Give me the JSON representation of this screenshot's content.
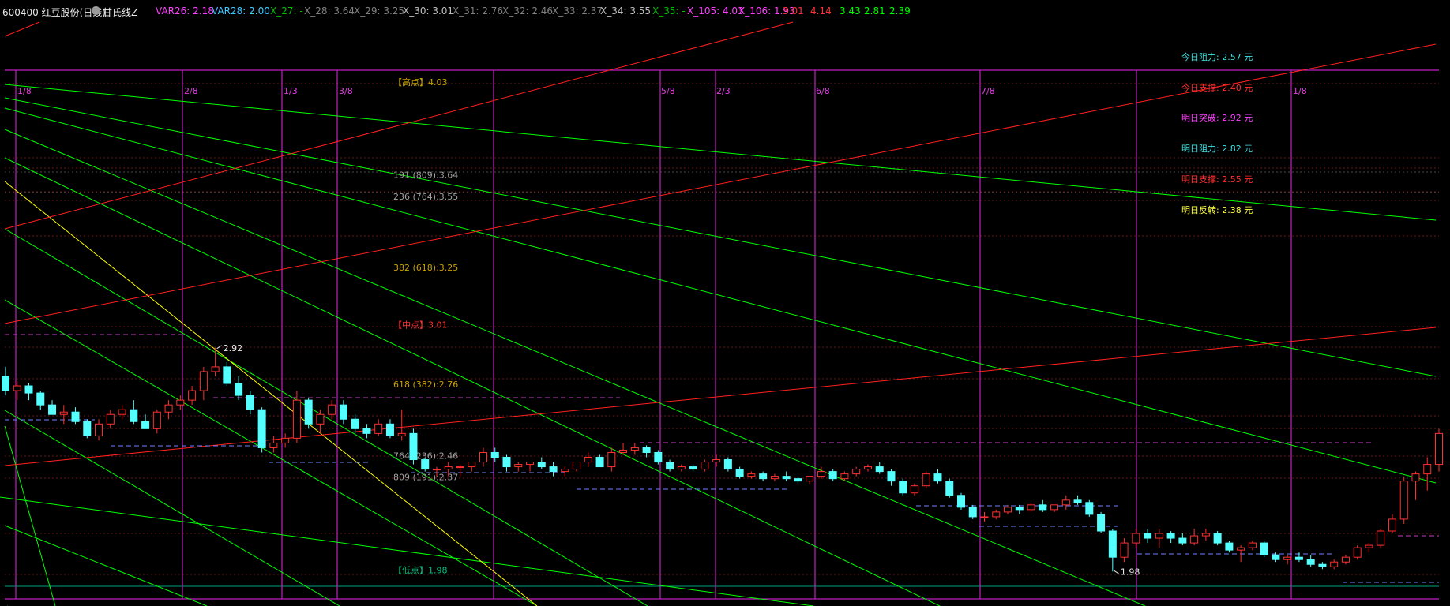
{
  "header": {
    "stock": "600400 红豆股份(日线)",
    "indicator": "甘氏线Z",
    "items": [
      {
        "text": "VAR26: 2.18",
        "color": "#ff40ff"
      },
      {
        "text": "VAR28: 2.00",
        "color": "#40c8ff"
      },
      {
        "text": "X_27: -",
        "color": "#00c000"
      },
      {
        "text": "X_28: 3.64",
        "color": "#808080"
      },
      {
        "text": "X_29: 3.25",
        "color": "#808080"
      },
      {
        "text": "X_30: 3.01",
        "color": "#c0c0c0"
      },
      {
        "text": "X_31: 2.76",
        "color": "#808080"
      },
      {
        "text": "X_32: 2.46",
        "color": "#808080"
      },
      {
        "text": "X_33: 2.37",
        "color": "#808080"
      },
      {
        "text": "X_34: 3.55",
        "color": "#c0c0c0"
      },
      {
        "text": "X_35: -",
        "color": "#00c000"
      },
      {
        "text": "X_105: 4.03",
        "color": "#ff40ff"
      },
      {
        "text": "X_106: 1.93",
        "color": "#ff40ff"
      },
      {
        "text": "3.01",
        "color": "#ff3030"
      },
      {
        "text": "4.14",
        "color": "#ff3030"
      },
      {
        "text": "3.43",
        "color": "#00ff00"
      },
      {
        "text": "2.81",
        "color": "#00ff00"
      },
      {
        "text": "2.39",
        "color": "#00ff00"
      }
    ]
  },
  "dates": [
    "1/8",
    "2/8",
    "1/3",
    "3/8",
    "5/8",
    "2/3",
    "6/8",
    "7/8",
    "1/8"
  ],
  "fib_levels": [
    {
      "label": "【高点】4.03",
      "value": 4.03,
      "color": "#c8a000"
    },
    {
      "label": "191 (809):3.64",
      "value": 3.64,
      "color": "#a0a0a0"
    },
    {
      "label": "236 (764):3.55",
      "value": 3.55,
      "color": "#a0a0a0"
    },
    {
      "label": "382 (618):3.25",
      "value": 3.25,
      "color": "#c8a000"
    },
    {
      "label": "【中点】3.01",
      "value": 3.01,
      "color": "#ff3030"
    },
    {
      "label": "618 (382):2.76",
      "value": 2.76,
      "color": "#c8a000"
    },
    {
      "label": "764 (236):2.46",
      "value": 2.46,
      "color": "#a0a0a0"
    },
    {
      "label": "809 (191):2.37",
      "value": 2.37,
      "color": "#a0a0a0"
    },
    {
      "label": "【低点】1.98",
      "value": 1.98,
      "color": "#00c080"
    }
  ],
  "right_panel": [
    {
      "label": "今日阻力: ",
      "value": "2.57 元",
      "color": "#40e0e0"
    },
    {
      "label": "今日支撑: ",
      "value": "2.40 元",
      "color": "#ff3030"
    },
    {
      "label": "明日突破: ",
      "value": "2.92 元",
      "color": "#ff40ff"
    },
    {
      "label": "明日阻力: ",
      "value": "2.82 元",
      "color": "#40e0e0"
    },
    {
      "label": "明日支撑: ",
      "value": "2.55 元",
      "color": "#ff3030"
    },
    {
      "label": "明日反转: ",
      "value": "2.38 元",
      "color": "#ffff40"
    }
  ],
  "peak_label": "2.92",
  "trough_label": "1.98",
  "colors": {
    "up": "#ff3030",
    "down": "#54ffff",
    "purple": "#c020c0",
    "green": "#00ff00",
    "red": "#ff2020",
    "yellow": "#ffff00"
  },
  "chart_data": {
    "type": "candlestick",
    "ylim": [
      1.9,
      4.34
    ],
    "ohlc": [
      [
        2.8,
        2.84,
        2.72,
        2.74
      ],
      [
        2.74,
        2.78,
        2.7,
        2.76
      ],
      [
        2.76,
        2.77,
        2.7,
        2.73
      ],
      [
        2.73,
        2.74,
        2.66,
        2.68
      ],
      [
        2.68,
        2.7,
        2.64,
        2.64
      ],
      [
        2.64,
        2.68,
        2.6,
        2.65
      ],
      [
        2.65,
        2.67,
        2.6,
        2.61
      ],
      [
        2.61,
        2.62,
        2.54,
        2.55
      ],
      [
        2.55,
        2.62,
        2.53,
        2.6
      ],
      [
        2.6,
        2.66,
        2.58,
        2.64
      ],
      [
        2.64,
        2.68,
        2.62,
        2.66
      ],
      [
        2.66,
        2.7,
        2.6,
        2.61
      ],
      [
        2.61,
        2.64,
        2.58,
        2.58
      ],
      [
        2.58,
        2.66,
        2.56,
        2.65
      ],
      [
        2.65,
        2.7,
        2.62,
        2.68
      ],
      [
        2.68,
        2.72,
        2.66,
        2.7
      ],
      [
        2.7,
        2.76,
        2.68,
        2.74
      ],
      [
        2.74,
        2.84,
        2.7,
        2.82
      ],
      [
        2.82,
        2.92,
        2.8,
        2.84
      ],
      [
        2.84,
        2.86,
        2.76,
        2.77
      ],
      [
        2.77,
        2.8,
        2.7,
        2.72
      ],
      [
        2.72,
        2.74,
        2.64,
        2.66
      ],
      [
        2.66,
        2.67,
        2.48,
        2.5
      ],
      [
        2.5,
        2.55,
        2.48,
        2.52
      ],
      [
        2.52,
        2.56,
        2.5,
        2.54
      ],
      [
        2.54,
        2.74,
        2.52,
        2.7
      ],
      [
        2.7,
        2.71,
        2.58,
        2.6
      ],
      [
        2.6,
        2.66,
        2.56,
        2.64
      ],
      [
        2.64,
        2.7,
        2.62,
        2.68
      ],
      [
        2.68,
        2.7,
        2.6,
        2.62
      ],
      [
        2.62,
        2.64,
        2.56,
        2.58
      ],
      [
        2.58,
        2.6,
        2.54,
        2.56
      ],
      [
        2.56,
        2.62,
        2.55,
        2.6
      ],
      [
        2.6,
        2.62,
        2.54,
        2.55
      ],
      [
        2.55,
        2.66,
        2.53,
        2.56
      ],
      [
        2.56,
        2.58,
        2.43,
        2.45
      ],
      [
        2.45,
        2.46,
        2.4,
        2.41
      ],
      [
        2.41,
        2.42,
        2.38,
        2.41
      ],
      [
        2.41,
        2.44,
        2.38,
        2.42
      ],
      [
        2.42,
        2.43,
        2.38,
        2.42
      ],
      [
        2.42,
        2.44,
        2.4,
        2.44
      ],
      [
        2.44,
        2.5,
        2.42,
        2.48
      ],
      [
        2.48,
        2.5,
        2.44,
        2.46
      ],
      [
        2.46,
        2.47,
        2.4,
        2.42
      ],
      [
        2.42,
        2.44,
        2.4,
        2.43
      ],
      [
        2.43,
        2.44,
        2.4,
        2.44
      ],
      [
        2.44,
        2.46,
        2.41,
        2.42
      ],
      [
        2.42,
        2.44,
        2.38,
        2.4
      ],
      [
        2.4,
        2.42,
        2.38,
        2.41
      ],
      [
        2.41,
        2.44,
        2.4,
        2.44
      ],
      [
        2.44,
        2.48,
        2.42,
        2.46
      ],
      [
        2.46,
        2.47,
        2.42,
        2.42
      ],
      [
        2.42,
        2.5,
        2.4,
        2.48
      ],
      [
        2.48,
        2.52,
        2.47,
        2.49
      ],
      [
        2.49,
        2.52,
        2.47,
        2.5
      ],
      [
        2.5,
        2.51,
        2.46,
        2.48
      ],
      [
        2.48,
        2.49,
        2.43,
        2.44
      ],
      [
        2.44,
        2.45,
        2.4,
        2.41
      ],
      [
        2.41,
        2.43,
        2.4,
        2.42
      ],
      [
        2.42,
        2.43,
        2.4,
        2.41
      ],
      [
        2.41,
        2.45,
        2.4,
        2.44
      ],
      [
        2.44,
        2.47,
        2.42,
        2.45
      ],
      [
        2.45,
        2.46,
        2.4,
        2.41
      ],
      [
        2.41,
        2.42,
        2.37,
        2.38
      ],
      [
        2.38,
        2.4,
        2.37,
        2.39
      ],
      [
        2.39,
        2.4,
        2.36,
        2.37
      ],
      [
        2.37,
        2.39,
        2.36,
        2.38
      ],
      [
        2.38,
        2.4,
        2.36,
        2.37
      ],
      [
        2.37,
        2.38,
        2.35,
        2.36
      ],
      [
        2.36,
        2.38,
        2.35,
        2.38
      ],
      [
        2.38,
        2.42,
        2.37,
        2.4
      ],
      [
        2.4,
        2.41,
        2.36,
        2.37
      ],
      [
        2.37,
        2.4,
        2.36,
        2.39
      ],
      [
        2.39,
        2.42,
        2.38,
        2.41
      ],
      [
        2.41,
        2.43,
        2.4,
        2.42
      ],
      [
        2.42,
        2.44,
        2.39,
        2.4
      ],
      [
        2.4,
        2.41,
        2.34,
        2.36
      ],
      [
        2.36,
        2.37,
        2.3,
        2.31
      ],
      [
        2.31,
        2.35,
        2.3,
        2.34
      ],
      [
        2.34,
        2.4,
        2.33,
        2.39
      ],
      [
        2.39,
        2.41,
        2.35,
        2.36
      ],
      [
        2.36,
        2.37,
        2.29,
        2.3
      ],
      [
        2.3,
        2.31,
        2.24,
        2.25
      ],
      [
        2.25,
        2.26,
        2.2,
        2.21
      ],
      [
        2.21,
        2.23,
        2.19,
        2.21
      ],
      [
        2.21,
        2.24,
        2.2,
        2.23
      ],
      [
        2.23,
        2.26,
        2.22,
        2.25
      ],
      [
        2.25,
        2.26,
        2.22,
        2.24
      ],
      [
        2.24,
        2.27,
        2.23,
        2.26
      ],
      [
        2.26,
        2.28,
        2.23,
        2.24
      ],
      [
        2.24,
        2.26,
        2.23,
        2.26
      ],
      [
        2.26,
        2.3,
        2.24,
        2.28
      ],
      [
        2.28,
        2.3,
        2.26,
        2.27
      ],
      [
        2.27,
        2.28,
        2.21,
        2.22
      ],
      [
        2.22,
        2.23,
        2.14,
        2.15
      ],
      [
        2.15,
        2.16,
        1.98,
        2.04
      ],
      [
        2.04,
        2.12,
        2.02,
        2.1
      ],
      [
        2.1,
        2.16,
        2.08,
        2.14
      ],
      [
        2.14,
        2.16,
        2.1,
        2.12
      ],
      [
        2.12,
        2.16,
        2.08,
        2.14
      ],
      [
        2.14,
        2.15,
        2.1,
        2.12
      ],
      [
        2.12,
        2.14,
        2.09,
        2.1
      ],
      [
        2.1,
        2.16,
        2.09,
        2.13
      ],
      [
        2.13,
        2.16,
        2.11,
        2.14
      ],
      [
        2.14,
        2.15,
        2.09,
        2.1
      ],
      [
        2.1,
        2.11,
        2.06,
        2.07
      ],
      [
        2.07,
        2.09,
        2.02,
        2.08
      ],
      [
        2.08,
        2.11,
        2.07,
        2.1
      ],
      [
        2.1,
        2.11,
        2.04,
        2.05
      ],
      [
        2.05,
        2.06,
        2.02,
        2.03
      ],
      [
        2.03,
        2.05,
        2.01,
        2.04
      ],
      [
        2.04,
        2.06,
        2.02,
        2.03
      ],
      [
        2.03,
        2.05,
        2.0,
        2.01
      ],
      [
        2.01,
        2.02,
        1.99,
        2.0
      ],
      [
        2.0,
        2.03,
        1.99,
        2.02
      ],
      [
        2.02,
        2.05,
        2.01,
        2.04
      ],
      [
        2.04,
        2.09,
        2.03,
        2.08
      ],
      [
        2.08,
        2.1,
        2.06,
        2.09
      ],
      [
        2.09,
        2.16,
        2.08,
        2.15
      ],
      [
        2.15,
        2.22,
        2.14,
        2.2
      ],
      [
        2.2,
        2.38,
        2.18,
        2.36
      ],
      [
        2.36,
        2.4,
        2.28,
        2.39
      ],
      [
        2.39,
        2.46,
        2.32,
        2.43
      ],
      [
        2.43,
        2.58,
        2.4,
        2.56
      ]
    ]
  }
}
